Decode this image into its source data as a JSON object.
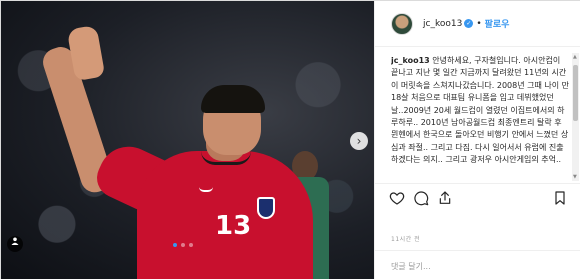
{
  "post": {
    "header": {
      "username": "jc_koo13",
      "verified_icon": "verified-badge-icon",
      "separator": "•",
      "follow_label": "팔로우"
    },
    "caption": {
      "username": "jc_koo13",
      "text": " 안녕하세요, 구자철입니다. 아시안컵이 끝나고 지난 몇 일간 지금까지 달려왔던 11년의 시간이 머릿속을 스쳐지나갔습니다. 2008년 그때 나이 만18살 처음으로 대표팀 유니폼을 입고 데뷔했었던 날..2009년 20세 월드컵이 열렸던 이집트에서의 하루하루.. 2010년 남아공월드컵 최종엔트리 탈락 후 뮌헨에서 한국으로 돌아오던 비행기 안에서 느꼈던 상심과 좌절.. 그리고 다짐. 다시 일어서서 유럽에 진출하겠다는 의지.. 그리고 광저우 아시안게임의 추억.."
    },
    "photo": {
      "jersey_number": "13",
      "next_icon": "chevron-right-icon",
      "tag_icon": "user-tag-icon",
      "carousel_total": 3,
      "carousel_active": 1
    },
    "actions": {
      "like_icon": "heart-icon",
      "comment_icon": "comment-icon",
      "share_icon": "share-icon",
      "save_icon": "bookmark-icon"
    },
    "timestamp": "11시간 전",
    "comment": {
      "placeholder": "댓글 달기..."
    },
    "colors": {
      "link_blue": "#3897f0",
      "jersey_red": "#c8102e",
      "text": "#262626"
    }
  }
}
